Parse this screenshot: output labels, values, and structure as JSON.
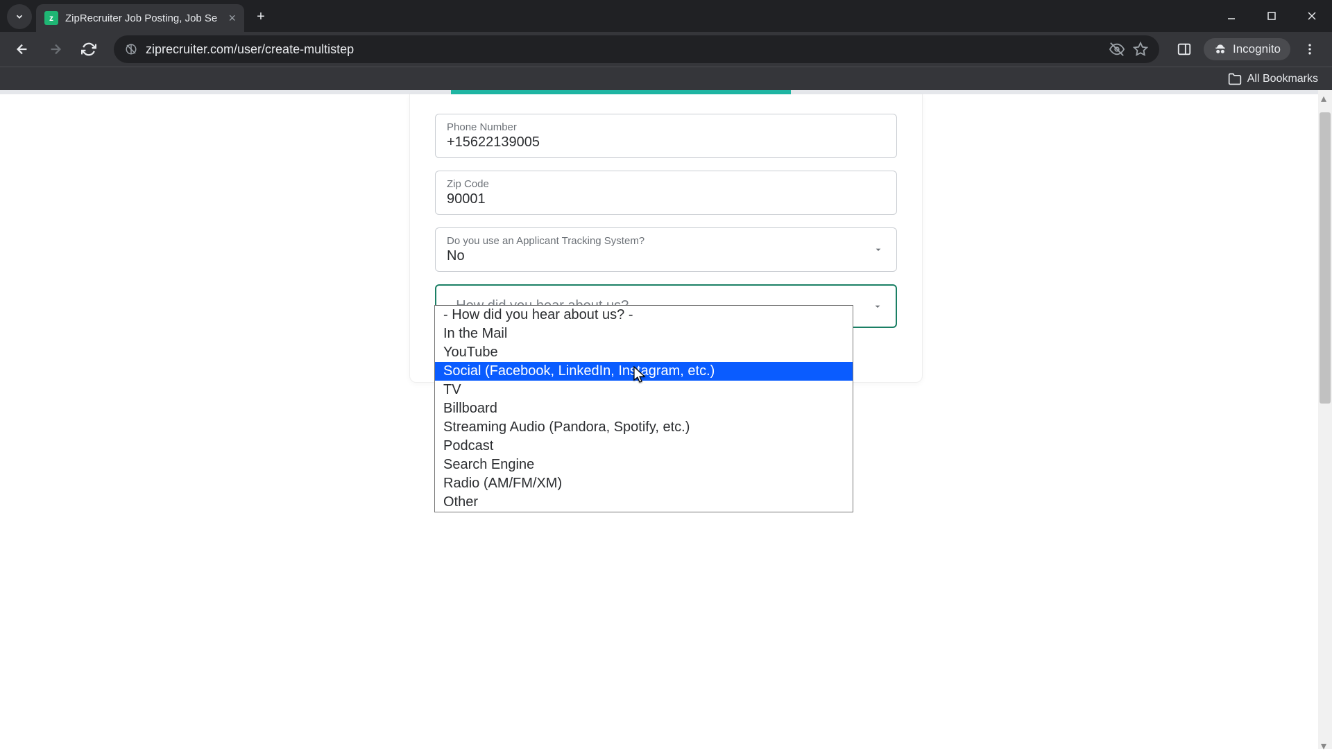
{
  "browser": {
    "tab_title": "ZipRecruiter Job Posting, Job Se",
    "url": "ziprecruiter.com/user/create-multistep",
    "incognito_label": "Incognito",
    "bookmarks_label": "All Bookmarks"
  },
  "form": {
    "phone": {
      "label": "Phone Number",
      "value": "+15622139005"
    },
    "zip": {
      "label": "Zip Code",
      "value": "90001"
    },
    "ats": {
      "label": "Do you use an Applicant Tracking System?",
      "value": "No"
    },
    "hear": {
      "placeholder": "- How did you hear about us? -",
      "options": [
        "- How did you hear about us? -",
        "In the Mail",
        "YouTube",
        "Social (Facebook, LinkedIn, Instagram, etc.)",
        "TV",
        "Billboard",
        "Streaming Audio (Pandora, Spotify, etc.)",
        "Podcast",
        "Search Engine",
        "Radio (AM/FM/XM)",
        "Other"
      ],
      "highlighted_index": 3
    }
  }
}
